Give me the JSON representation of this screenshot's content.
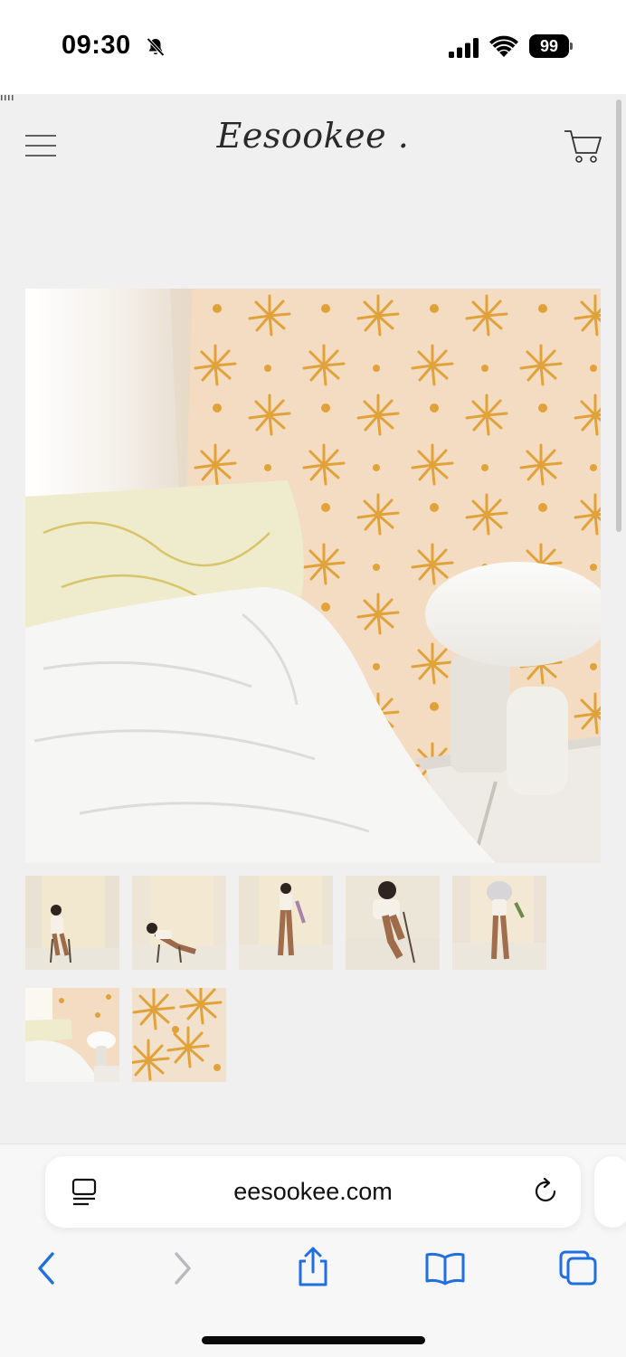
{
  "status_bar": {
    "time": "09:30",
    "battery_level": "99",
    "icons": [
      "bell-slash-icon",
      "cellular-signal-icon",
      "wifi-icon",
      "battery-icon"
    ]
  },
  "header": {
    "brand": "Eesookee .",
    "icons": [
      "hamburger-menu-icon",
      "shopping-cart-icon"
    ]
  },
  "gallery": {
    "main_image": "bedroom with sunburst wallpaper, mushroom lamp and white duvet",
    "thumbnail_count": 7
  },
  "browser": {
    "url": "eesookee.com",
    "icons": [
      "page-menu-icon",
      "reload-icon",
      "back-icon",
      "forward-icon",
      "share-icon",
      "bookmarks-icon",
      "tabs-icon"
    ]
  },
  "colors": {
    "page_background": "#f0f0f0",
    "browser_accent": "#1f6fe0",
    "wallpaper": "#f4dcc3",
    "motif": "#e2a23a"
  }
}
